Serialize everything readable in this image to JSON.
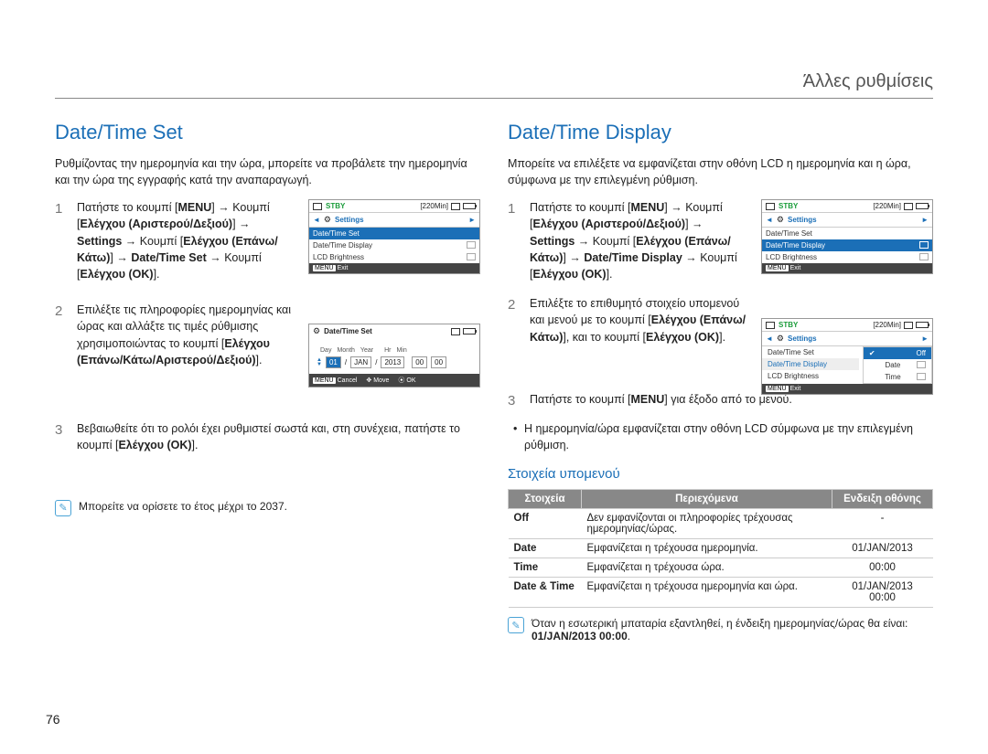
{
  "header": {
    "category": "Άλλες ρυθμίσεις"
  },
  "page_number": "76",
  "left": {
    "title": "Date/Time Set",
    "intro": "Ρυθμίζοντας την ημερομηνία και την ώρα, μπορείτε να προβάλετε την ημερομηνία και την ώρα της εγγραφής κατά την αναπαραγωγή.",
    "steps": {
      "s1": {
        "t1": "Πατήστε το κουμπί [",
        "b1": "MENU",
        "t2": "] → Κουμπί [",
        "b2": "Ελέγχου (Αριστερού/Δεξιού)",
        "t3": "] → ",
        "b3": "Settings",
        "t4": " → Κουμπί [",
        "b4": "Ελέγχου (Επάνω/Κάτω)",
        "t5": "] → ",
        "b5": "Date/Time Set",
        "t6": " → Κουμπί [",
        "b6": "Ελέγχου (OK)",
        "t7": "]."
      },
      "s2": {
        "t1": "Επιλέξτε τις πληροφορίες ημερομηνίας και ώρας και αλλάξτε τις τιμές ρύθμισης χρησιμοποιώντας το κουμπί [",
        "b1": "Ελέγχου (Επάνω/Κάτω/Αριστερού/Δεξιού)",
        "t2": "]."
      },
      "s3": {
        "t1": "Βεβαιωθείτε ότι το ρολόι έχει ρυθμιστεί σωστά και, στη συνέχεια, πατήστε το κουμπί [",
        "b1": "Ελέγχου (OK)",
        "t2": "]."
      }
    },
    "note": "Μπορείτε να ορίσετε το έτος μέχρι το 2037.",
    "lcd1": {
      "stby": "STBY",
      "time_remain": "[220Min]",
      "settings_tab": "Settings",
      "item_sel": "Date/Time Set",
      "item2": "Date/Time Display",
      "item3": "LCD Brightness",
      "exit": "Exit",
      "menu": "MENU"
    },
    "lcd2": {
      "title": "Date/Time Set",
      "lbl_day": "Day",
      "lbl_month": "Month",
      "lbl_year": "Year",
      "lbl_hr": "Hr",
      "lbl_min": "Min",
      "val_day": "01",
      "val_month": "JAN",
      "val_year": "2013",
      "val_hr": "00",
      "val_min": "00",
      "cancel": "Cancel",
      "move": "Move",
      "ok": "OK",
      "menu": "MENU"
    }
  },
  "right": {
    "title": "Date/Time Display",
    "intro": "Μπορείτε να επιλέξετε να εμφανίζεται στην οθόνη LCD η ημερομηνία και η ώρα, σύμφωνα με την επιλεγμένη ρύθμιση.",
    "steps": {
      "s1": {
        "t1": "Πατήστε το κουμπί [",
        "b1": "MENU",
        "t2": "] → Κουμπί [",
        "b2": "Ελέγχου (Αριστερού/Δεξιού)",
        "t3": "] → ",
        "b3": "Settings",
        "t4": " → Κουμπί [",
        "b4": "Ελέγχου (Επάνω/Κάτω)",
        "t5": "] → ",
        "b5": "Date/Time Display",
        "t6": " → Κουμπί [",
        "b6": "Ελέγχου (OK)",
        "t7": "]."
      },
      "s2": {
        "t1": "Επιλέξτε το επιθυμητό στοιχείο υπομενού και μενού με το κουμπί [",
        "b1": "Ελέγχου (Επάνω/Κάτω)",
        "t2": "], και το κουμπί [",
        "b2": "Ελέγχου (OK)",
        "t3": "]."
      },
      "s3": {
        "t1": "Πατήστε το κουμπί [",
        "b1": "MENU",
        "t2": "] για έξοδο από το μενού."
      }
    },
    "bullet": "Η ημερομηνία/ώρα εμφανίζεται στην οθόνη LCD σύμφωνα με την επιλεγμένη ρύθμιση.",
    "submenu_heading": "Στοιχεία υπομενού",
    "table": {
      "h1": "Στοιχεία",
      "h2": "Περιεχόμενα",
      "h3": "Ενδειξη οθόνης",
      "r1c1": "Off",
      "r1c2": "Δεν εμφανίζονται οι πληροφορίες τρέχουσας ημερομηνίας/ώρας.",
      "r1c3": "-",
      "r2c1": "Date",
      "r2c2": "Εμφανίζεται η τρέχουσα ημερομηνία.",
      "r2c3": "01/JAN/2013",
      "r3c1": "Time",
      "r3c2": "Εμφανίζεται η τρέχουσα ώρα.",
      "r3c3": "00:00",
      "r4c1": "Date & Time",
      "r4c2": "Εμφανίζεται η τρέχουσα ημερομηνία και ώρα.",
      "r4c3a": "01/JAN/2013",
      "r4c3b": "00:00"
    },
    "note_a": "Όταν η εσωτερική μπαταρία εξαντληθεί, η ένδειξη ημερομηνίας/ώρας θα είναι: ",
    "note_b": "01/JAN/2013 00:00",
    "note_c": ".",
    "lcd1": {
      "stby": "STBY",
      "time_remain": "[220Min]",
      "settings_tab": "Settings",
      "item1": "Date/Time Set",
      "item_sel": "Date/Time Display",
      "item3": "LCD Brightness",
      "exit": "Exit",
      "menu": "MENU"
    },
    "lcd2": {
      "stby": "STBY",
      "time_remain": "[220Min]",
      "settings_tab": "Settings",
      "left_item1": "Date/Time Set",
      "left_item2": "Date/Time Display",
      "left_item3": "LCD Brightness",
      "opt_off": "Off",
      "opt_date": "Date",
      "opt_time": "Time",
      "exit": "Exit",
      "menu": "MENU"
    }
  }
}
